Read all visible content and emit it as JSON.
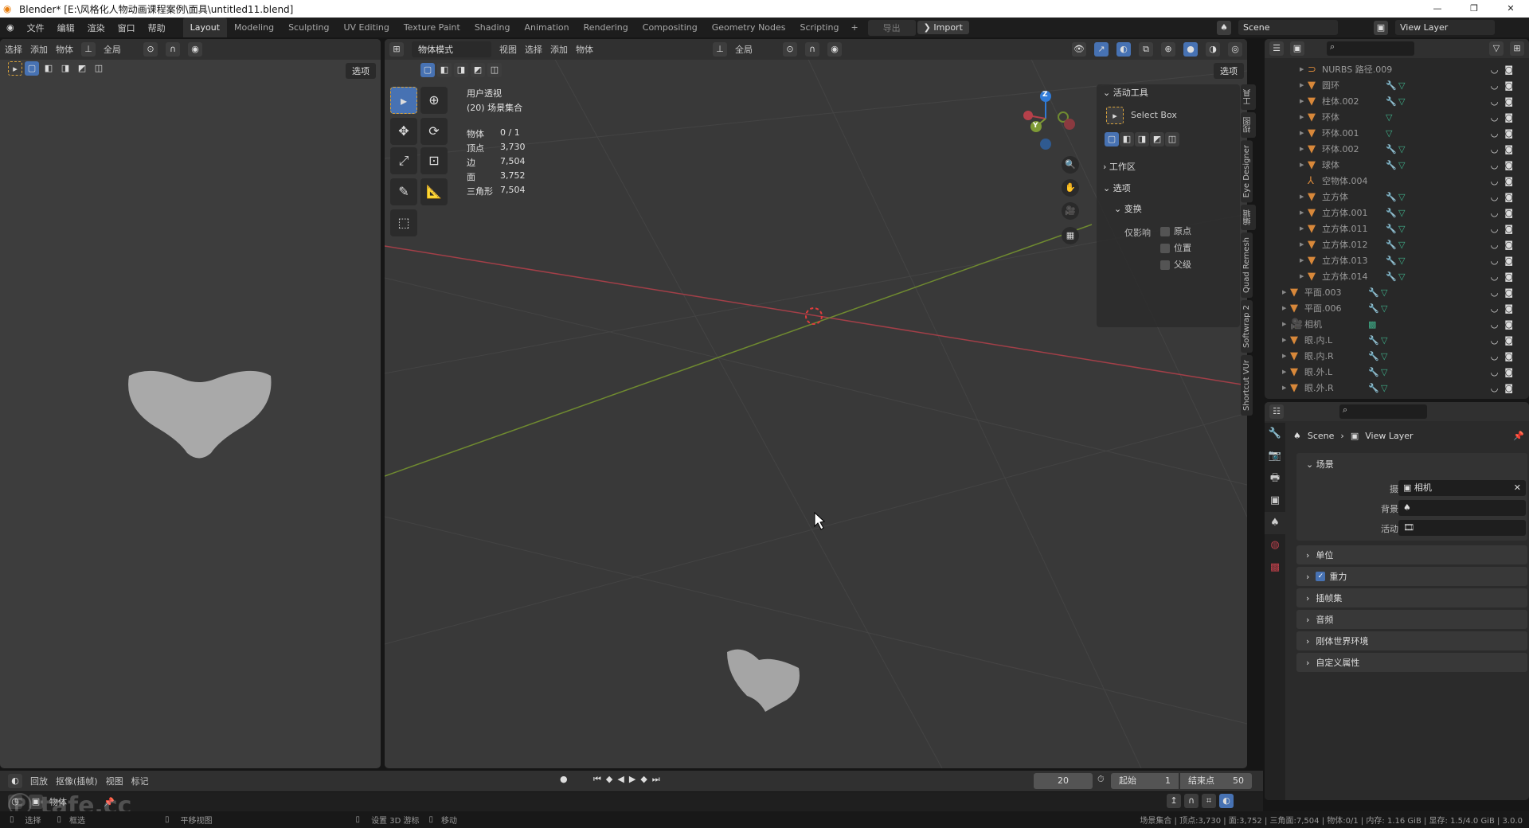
{
  "window": {
    "title": "Blender* [E:\\风格化人物动画课程案例\\面具\\untitled11.blend]",
    "controls": [
      "—",
      "❐",
      "✕"
    ]
  },
  "menu": [
    "文件",
    "编辑",
    "渲染",
    "窗口",
    "帮助"
  ],
  "workspaces": [
    {
      "label": "Layout",
      "active": true
    },
    {
      "label": "Modeling"
    },
    {
      "label": "Sculpting"
    },
    {
      "label": "UV Editing"
    },
    {
      "label": "Texture Paint"
    },
    {
      "label": "Shading"
    },
    {
      "label": "Animation"
    },
    {
      "label": "Rendering"
    },
    {
      "label": "Compositing"
    },
    {
      "label": "Geometry Nodes"
    },
    {
      "label": "Scripting"
    }
  ],
  "topbar": {
    "add": "+",
    "export": "导出",
    "import": "Import",
    "scene": "Scene",
    "view_layer": "View Layer"
  },
  "left_view": {
    "menu": [
      "选择",
      "添加",
      "物体"
    ],
    "orientation": "全局",
    "options": "选项"
  },
  "main_view": {
    "mode": "物体模式",
    "menu": [
      "视图",
      "选择",
      "添加",
      "物体"
    ],
    "orientation": "全局",
    "options": "选项",
    "overlay": {
      "view_name": "用户透视",
      "collection": "(20) 场景集合",
      "stats": [
        {
          "label": "物体",
          "value": "0 / 1"
        },
        {
          "label": "顶点",
          "value": "3,730"
        },
        {
          "label": "边",
          "value": "7,504"
        },
        {
          "label": "面",
          "value": "3,752"
        },
        {
          "label": "三角形",
          "value": "7,504"
        }
      ]
    },
    "gizmo": {
      "z": "Z",
      "y": "Y"
    }
  },
  "npanel": {
    "active_tool": "活动工具",
    "tool_name": "Select Box",
    "workspace": "工作区",
    "options": "选项",
    "transform": "变换",
    "affect_only": "仅影响",
    "checks": [
      "原点",
      "位置",
      "父级"
    ]
  },
  "side_tabs": [
    "工具",
    "视图",
    "Eye Designer",
    "编辑",
    "Quad Remesh",
    "Softwrap 2",
    "Shortcut VUr"
  ],
  "outliner": {
    "items": [
      {
        "name": "NURBS 路径.009",
        "type": "curve",
        "indent": 2
      },
      {
        "name": "圆环",
        "type": "mesh",
        "indent": 2,
        "mod": true
      },
      {
        "name": "柱体.002",
        "type": "mesh",
        "indent": 2,
        "mod": true
      },
      {
        "name": "环体",
        "type": "mesh",
        "indent": 2
      },
      {
        "name": "环体.001",
        "type": "mesh",
        "indent": 2
      },
      {
        "name": "环体.002",
        "type": "mesh",
        "indent": 2,
        "mod": true
      },
      {
        "name": "球体",
        "type": "mesh",
        "indent": 2,
        "mod": true
      },
      {
        "name": "空物体.004",
        "type": "empty",
        "indent": 2
      },
      {
        "name": "立方体",
        "type": "mesh",
        "indent": 2,
        "mod": true
      },
      {
        "name": "立方体.001",
        "type": "mesh",
        "indent": 2,
        "mod": true
      },
      {
        "name": "立方体.011",
        "type": "mesh",
        "indent": 2,
        "mod": true
      },
      {
        "name": "立方体.012",
        "type": "mesh",
        "indent": 2,
        "mod": true
      },
      {
        "name": "立方体.013",
        "type": "mesh",
        "indent": 2,
        "mod": true
      },
      {
        "name": "立方体.014",
        "type": "mesh",
        "indent": 2,
        "mod": true
      },
      {
        "name": "平面.003",
        "type": "mesh",
        "indent": 1,
        "mod": true
      },
      {
        "name": "平面.006",
        "type": "mesh",
        "indent": 1,
        "mod": true
      },
      {
        "name": "相机",
        "type": "camera",
        "indent": 1
      },
      {
        "name": "眼.内.L",
        "type": "mesh",
        "indent": 1,
        "mod": true
      },
      {
        "name": "眼.内.R",
        "type": "mesh",
        "indent": 1,
        "mod": true
      },
      {
        "name": "眼.外.L",
        "type": "mesh",
        "indent": 1,
        "mod": true
      },
      {
        "name": "眼.外.R",
        "type": "mesh",
        "indent": 1,
        "mod": true
      }
    ]
  },
  "properties": {
    "breadcrumb": [
      "Scene",
      "View Layer"
    ],
    "scene_section": "场景",
    "fields": [
      {
        "label": "摄像机",
        "value": "相机"
      },
      {
        "label": "背景场景",
        "value": ""
      },
      {
        "label": "活动剪辑",
        "value": ""
      }
    ],
    "sections": [
      {
        "label": "单位"
      },
      {
        "label": "重力",
        "checked": true
      },
      {
        "label": "插帧集"
      },
      {
        "label": "音频"
      },
      {
        "label": "刚体世界环境"
      },
      {
        "label": "自定义属性"
      }
    ]
  },
  "timeline": {
    "menu": [
      "回放",
      "抠像(插帧)",
      "视图",
      "标记"
    ],
    "current_frame": "20",
    "start_label": "起始",
    "start": "1",
    "end_label": "结束点",
    "end": "50"
  },
  "bottom_header": {
    "mode": "物体"
  },
  "statusbar": {
    "hints": [
      "选择",
      "框选",
      "平移视图",
      "设置 3D 游标",
      "移动"
    ],
    "info": "场景集合 | 顶点:3,730 | 面:3,752 | 三角面:7,504 | 物体:0/1 | 内存: 1.16 GiB | 显存: 1.5/4.0 GiB | 3.0.0"
  },
  "watermark": "tafe.cc",
  "colors": {
    "accent": "#4772b3",
    "x_axis": "#b5404a",
    "y_axis": "#7e9a36",
    "z_axis": "#2f7bd8",
    "object_icon": "#d8883a",
    "mesh_data": "#3fb08a"
  }
}
